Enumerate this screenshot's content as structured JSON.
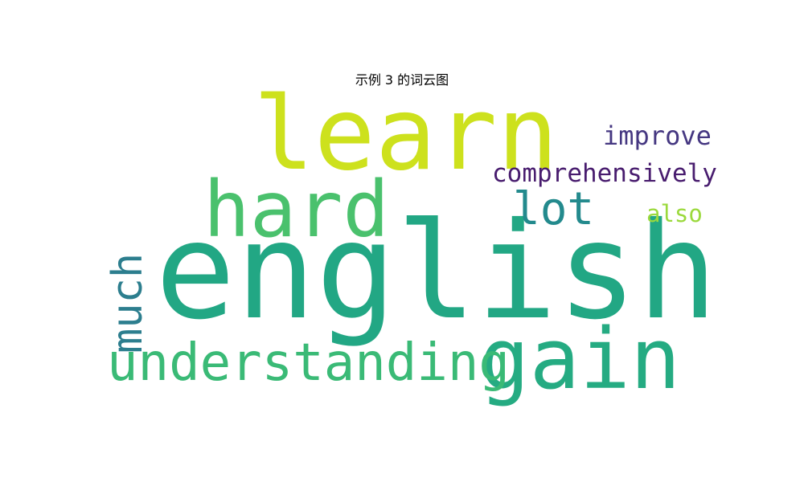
{
  "title": "示例 3 的词云图",
  "words": [
    {
      "key": "english",
      "text": "english",
      "color": "#22a784"
    },
    {
      "key": "learn",
      "text": "learn",
      "color": "#cde11d"
    },
    {
      "key": "hard",
      "text": "hard",
      "color": "#4ac16d"
    },
    {
      "key": "gain",
      "text": "gain",
      "color": "#25ab82"
    },
    {
      "key": "understanding",
      "text": "understanding",
      "color": "#3aba76"
    },
    {
      "key": "much",
      "text": "much",
      "color": "#2c7e8e"
    },
    {
      "key": "lot",
      "text": "lot",
      "color": "#238a8d"
    },
    {
      "key": "improve",
      "text": "improve",
      "color": "#453781"
    },
    {
      "key": "comprehensively",
      "text": "comprehensively",
      "color": "#481c6e"
    },
    {
      "key": "also",
      "text": "also",
      "color": "#9bd93c"
    }
  ]
}
